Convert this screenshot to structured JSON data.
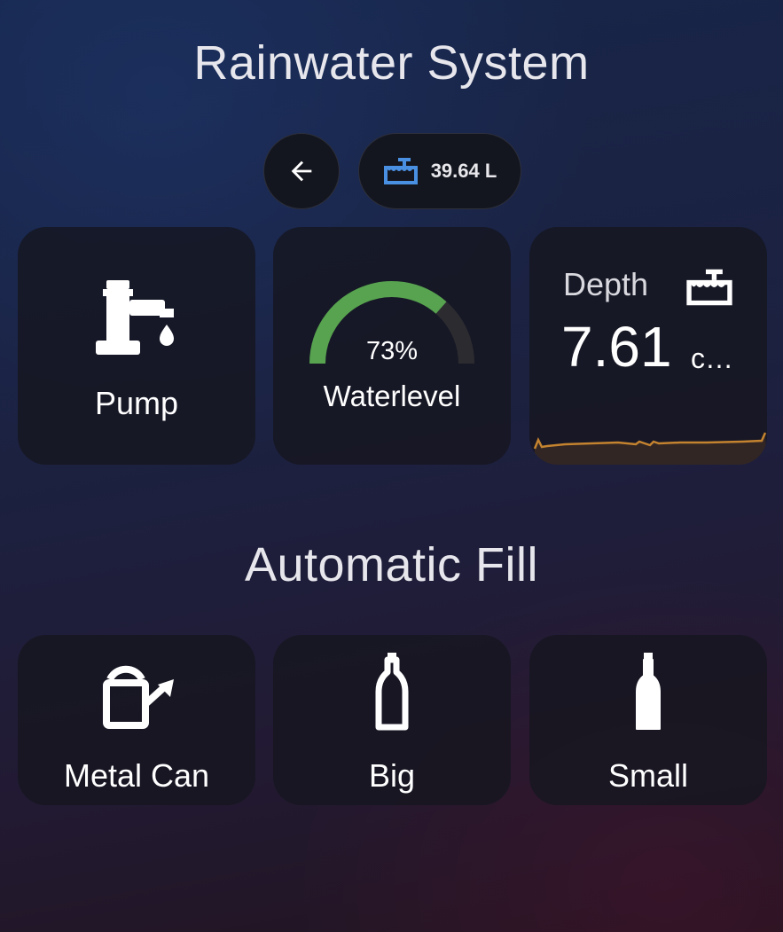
{
  "header": {
    "title": "Rainwater System"
  },
  "chips": {
    "back": {
      "icon": "arrow-left-icon"
    },
    "volume": {
      "icon": "water-tank-icon",
      "value": "39.64 L",
      "icon_color": "#4a90e2"
    }
  },
  "cards": {
    "pump": {
      "label": "Pump",
      "icon": "water-pump-icon"
    },
    "waterlevel": {
      "label": "Waterlevel",
      "percent_text": "73%",
      "percent": 73,
      "gauge_color": "#57a34f",
      "track_color": "#2c2c30"
    },
    "depth": {
      "title": "Depth",
      "value": "7.61",
      "unit": "c…",
      "icon": "water-tank-icon",
      "graph_color": "#c4832f"
    }
  },
  "automatic_fill": {
    "title": "Automatic Fill",
    "items": [
      {
        "label": "Metal Can",
        "icon": "watering-can-icon"
      },
      {
        "label": "Big",
        "icon": "bottle-outline-icon"
      },
      {
        "label": "Small",
        "icon": "bottle-filled-icon"
      }
    ]
  }
}
